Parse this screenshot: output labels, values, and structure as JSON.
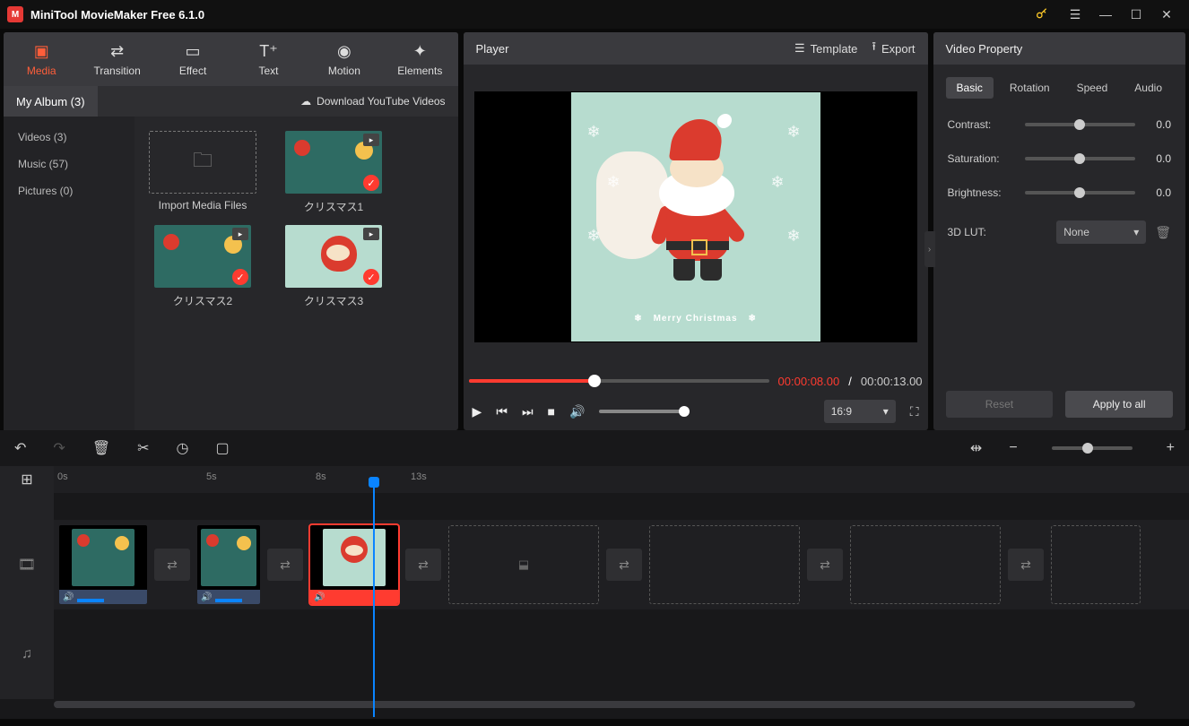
{
  "titlebar": {
    "title": "MiniTool MovieMaker Free 6.1.0"
  },
  "toolTabs": {
    "media": "Media",
    "transition": "Transition",
    "effect": "Effect",
    "text": "Text",
    "motion": "Motion",
    "elements": "Elements"
  },
  "subRow": {
    "myAlbum": "My Album (3)",
    "download": "Download YouTube Videos"
  },
  "sideNav": {
    "videos": "Videos (3)",
    "music": "Music (57)",
    "pictures": "Pictures (0)"
  },
  "media": {
    "import": "Import Media Files",
    "clip1": "クリスマス1",
    "clip2": "クリスマス2",
    "clip3": "クリスマス3"
  },
  "player": {
    "title": "Player",
    "template": "Template",
    "export": "Export",
    "timeNow": "00:00:08.00",
    "timeSep": "/",
    "timeTotal": "00:00:13.00",
    "aspect": "16:9",
    "merry": "Merry Christmas"
  },
  "props": {
    "title": "Video Property",
    "tabs": {
      "basic": "Basic",
      "rotation": "Rotation",
      "speed": "Speed",
      "audio": "Audio"
    },
    "contrast": {
      "label": "Contrast:",
      "value": "0.0"
    },
    "saturation": {
      "label": "Saturation:",
      "value": "0.0"
    },
    "brightness": {
      "label": "Brightness:",
      "value": "0.0"
    },
    "lut": {
      "label": "3D LUT:",
      "value": "None"
    },
    "reset": "Reset",
    "apply": "Apply to all"
  },
  "ruler": {
    "t0": "0s",
    "t5": "5s",
    "t8": "8s",
    "t13": "13s"
  }
}
